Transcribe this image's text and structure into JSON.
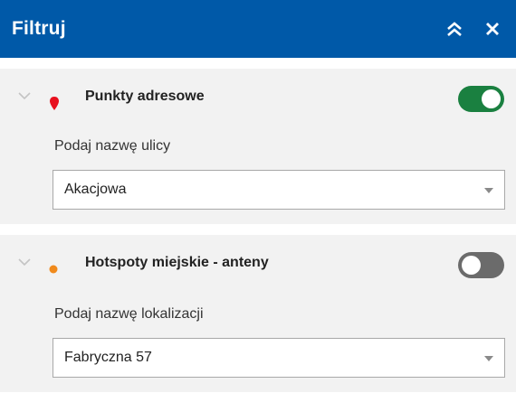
{
  "header": {
    "title": "Filtruj"
  },
  "layers": [
    {
      "name": "Punkty adresowe",
      "enabled": true,
      "marker_color": "#e8101e",
      "field_label": "Podaj nazwę ulicy",
      "selected_value": "Akacjowa"
    },
    {
      "name": "Hotspoty miejskie - anteny",
      "enabled": false,
      "marker_color": "#f08a1c",
      "field_label": "Podaj nazwę lokalizacji",
      "selected_value": "Fabryczna 57"
    }
  ],
  "colors": {
    "header_bg": "#0059a8",
    "toggle_on": "#1a8040",
    "toggle_off": "#6b6b6b",
    "section_bg": "#f2f2f2"
  }
}
